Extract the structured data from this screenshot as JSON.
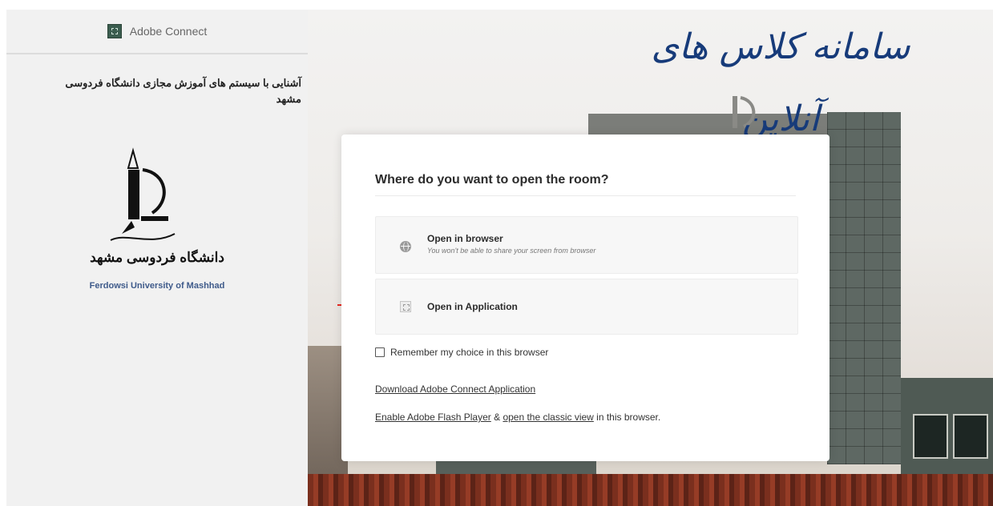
{
  "sidebar": {
    "app_name": "Adobe Connect",
    "description": "آشنایی با سیستم های آموزش مجازی دانشگاه فردوسی مشهد",
    "university_name_fa": "دانشگاه فردوسی مشهد",
    "university_name_en": "Ferdowsi University of Mashhad"
  },
  "banner": {
    "title": "سامانه کلاس های آنلاین"
  },
  "dialog": {
    "title": "Where do you want to open the room?",
    "options": [
      {
        "label": "Open in browser",
        "sublabel": "You won't be able to share your screen from browser",
        "icon": "globe-icon"
      },
      {
        "label": "Open in Application",
        "sublabel": "",
        "icon": "application-icon"
      }
    ],
    "remember_label": "Remember my choice in this browser",
    "remember_checked": false,
    "download_link": "Download Adobe Connect Application",
    "flash_link": "Enable Adobe Flash Player",
    "flash_connector": " & ",
    "classic_link": "open the classic view",
    "flash_suffix": " in this browser."
  },
  "colors": {
    "annotation_arrow": "#e8271f",
    "banner_text": "#173b7a",
    "university_name_en": "#3e5a8a"
  }
}
